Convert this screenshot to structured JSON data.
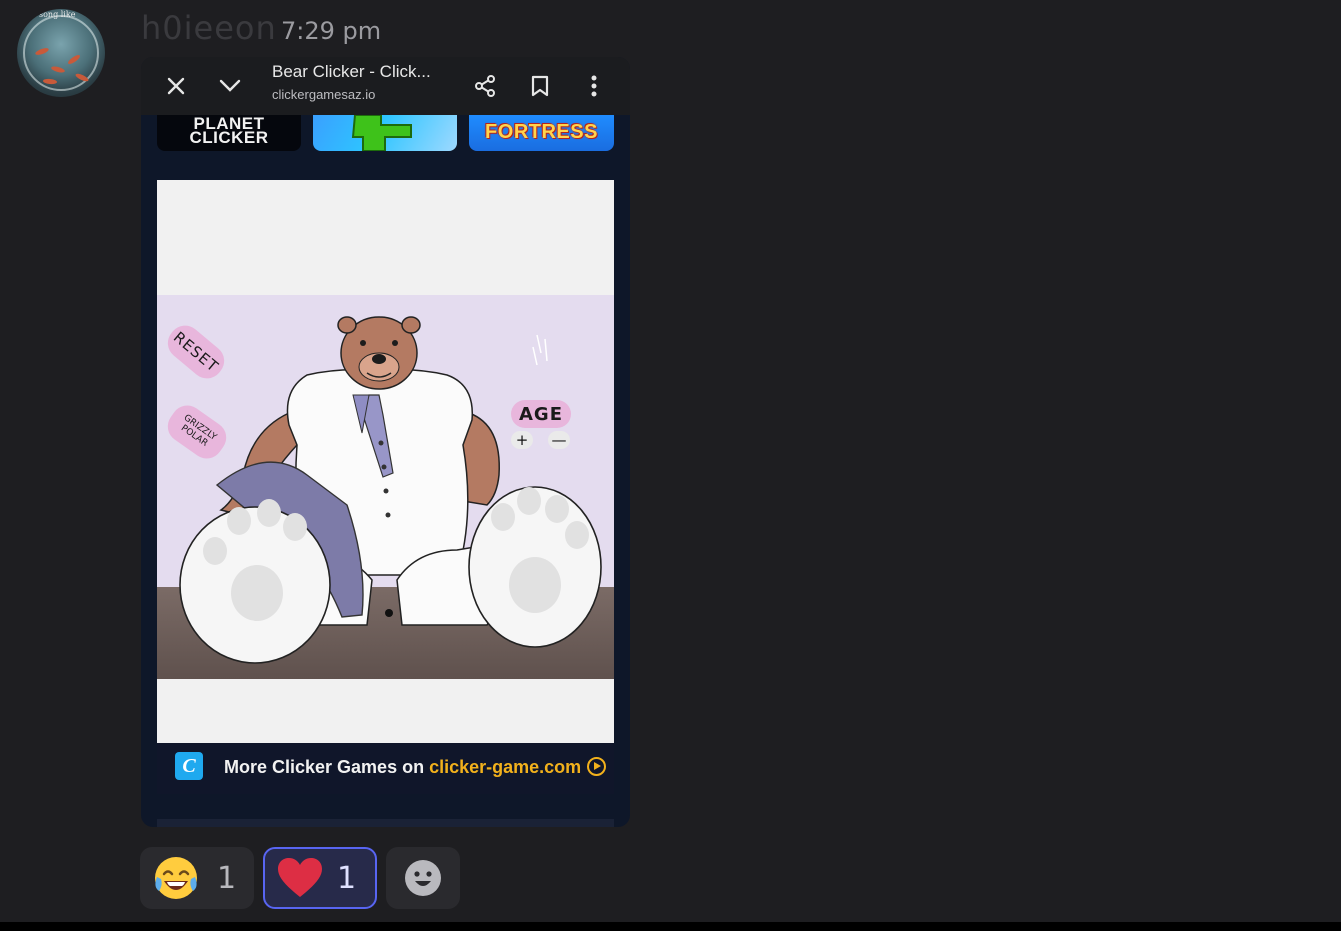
{
  "message": {
    "author": "h0ieeon",
    "time": "7:29 pm",
    "avatar_text": "song like"
  },
  "browser": {
    "title": "Bear Clicker - Click...",
    "url": "clickergamesaz.io",
    "icons": [
      "close-icon",
      "chevron-down-icon",
      "share-icon",
      "bookmark-icon",
      "more-vert-icon"
    ]
  },
  "thumbnails": [
    {
      "name": "planet-clicker",
      "label_line1": "PLANET",
      "label_line2": "CLICKER"
    },
    {
      "name": "blocks-game",
      "label": ""
    },
    {
      "name": "fortress",
      "label": "FORTRESS"
    }
  ],
  "game": {
    "reset_label": "RESET",
    "grizzly_label": "GRIZZLY",
    "polar_label": "POLAR",
    "age_label": "AGE",
    "age_plus": "+",
    "age_minus": "—"
  },
  "promo": {
    "logo_glyph": "C",
    "text": "More Clicker Games on ",
    "link": "clicker-game.com"
  },
  "reactions": [
    {
      "emoji": "laughing-emoji",
      "count": "1",
      "selected": false
    },
    {
      "emoji": "heart-emoji",
      "count": "1",
      "selected": true
    },
    {
      "emoji": "add-reaction-icon",
      "count": "",
      "selected": false
    }
  ],
  "colors": {
    "background": "#1e1e21",
    "selected_reaction_border": "#5865f2",
    "promo_link": "#f2b11c"
  }
}
